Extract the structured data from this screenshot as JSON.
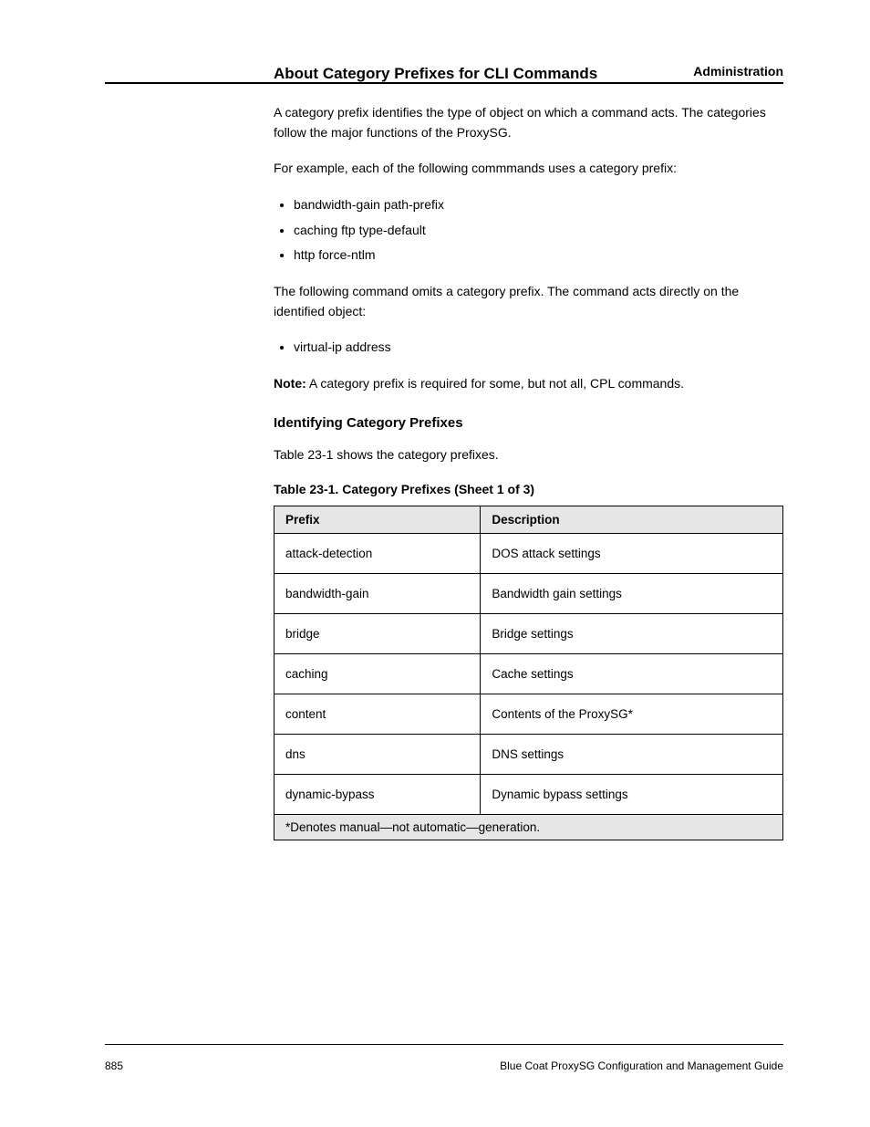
{
  "header": {
    "right": "Administration"
  },
  "section_title": "About Category Prefixes for CLI Commands",
  "para1": "A category prefix identifies the type of object on which a command acts. The categories follow the major functions of the ProxySG.",
  "para2": "For example, each of the following commmands uses a category prefix:",
  "bullets": [
    "bandwidth-gain path-prefix",
    "caching ftp type-default",
    "http force-ntlm"
  ],
  "para3": "The following command omits a category prefix. The command acts directly on the identified object:",
  "code_line": "virtual-ip address",
  "note_key": "Note:",
  "note_body": "A category prefix is required for some, but not all, CPL commands.",
  "subtitle": "Identifying Category Prefixes",
  "para4": "Table 23-1 shows the category prefixes.",
  "table": {
    "title": "Table 23-1. Category Prefixes (Sheet 1 of 3)",
    "headers": [
      "Prefix",
      "Description"
    ],
    "rows": [
      [
        "attack-detection",
        "DOS attack settings"
      ],
      [
        "bandwidth-gain",
        "Bandwidth gain settings"
      ],
      [
        "bridge",
        "Bridge settings"
      ],
      [
        "caching",
        "Cache settings"
      ],
      [
        "content",
        "Contents of the ProxySG*"
      ],
      [
        "dns",
        "DNS settings"
      ],
      [
        "dynamic-bypass",
        "Dynamic bypass settings"
      ]
    ],
    "footnote": "*Denotes manual—not automatic—generation."
  },
  "footer": {
    "left": "885",
    "right": "Blue Coat ProxySG Configuration and Management Guide"
  }
}
